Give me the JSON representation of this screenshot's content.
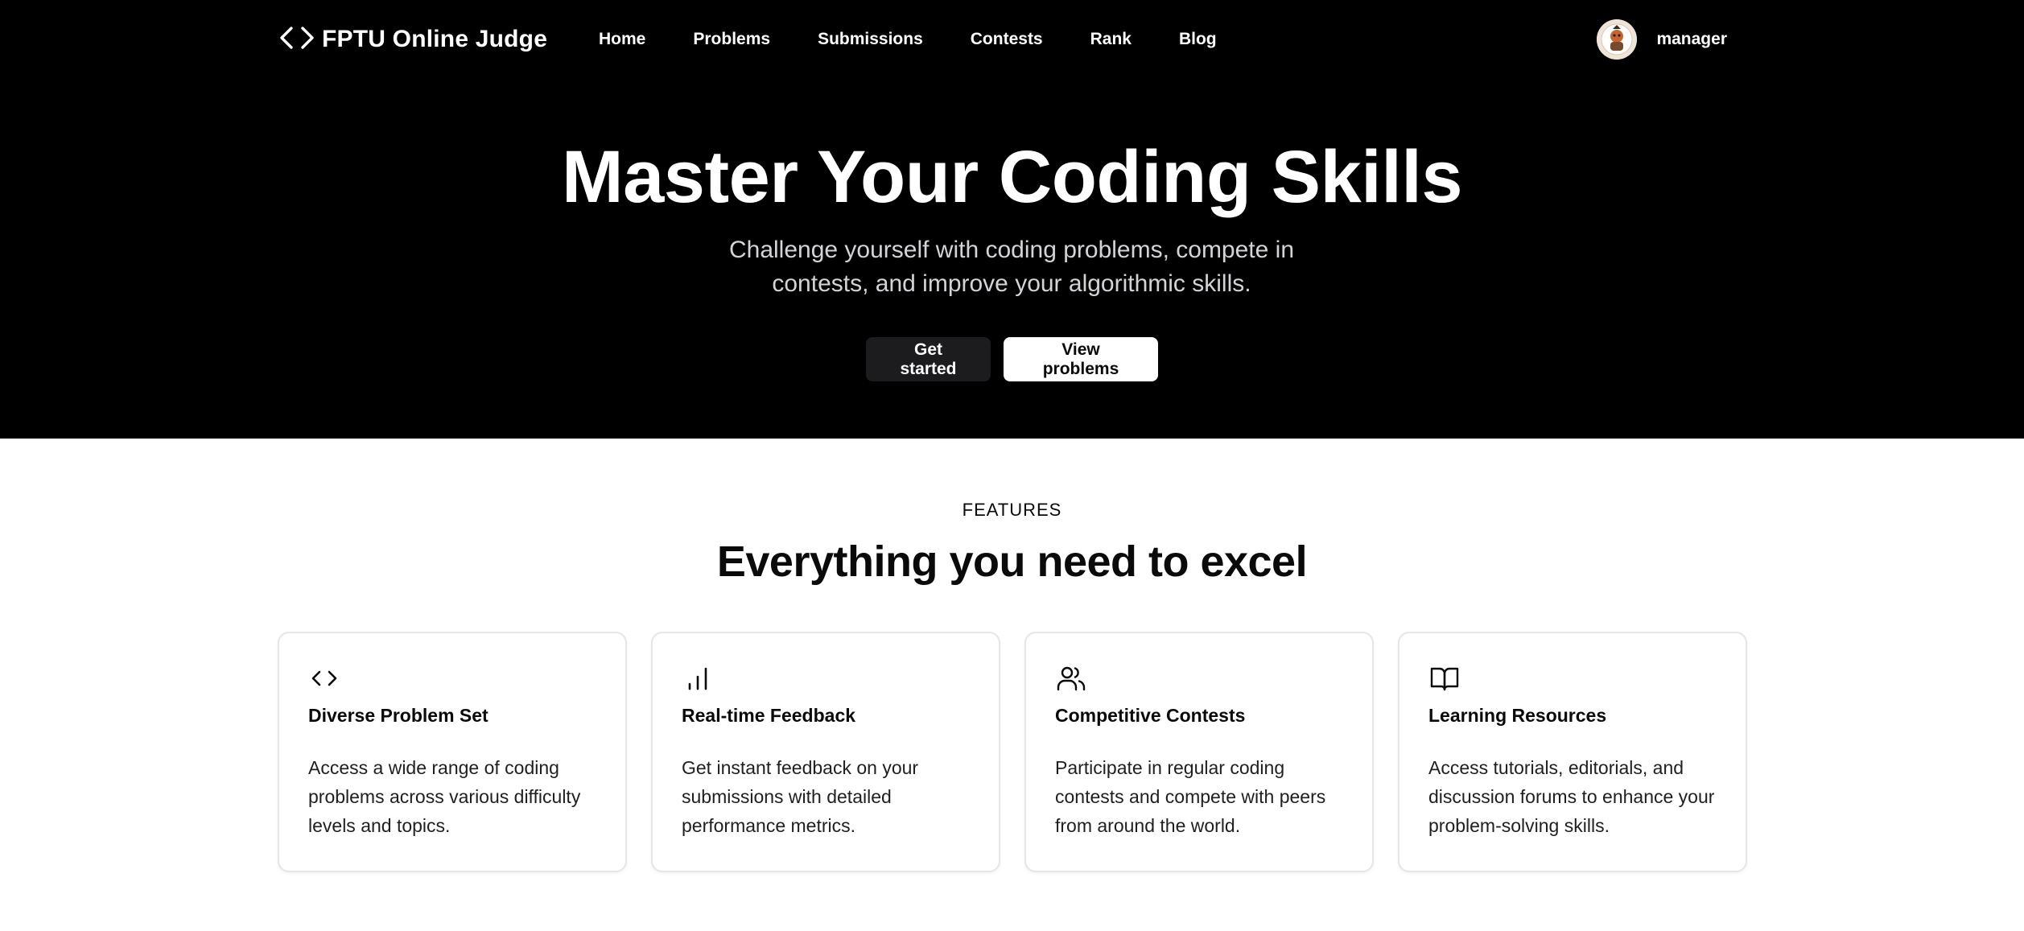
{
  "brand": {
    "name": "FPTU Online Judge",
    "icon": "code-brackets-icon"
  },
  "nav": {
    "items": [
      {
        "label": "Home"
      },
      {
        "label": "Problems"
      },
      {
        "label": "Submissions"
      },
      {
        "label": "Contests"
      },
      {
        "label": "Rank"
      },
      {
        "label": "Blog"
      }
    ]
  },
  "user": {
    "name": "manager",
    "avatar_icon": "user-avatar"
  },
  "hero": {
    "title": "Master Your Coding Skills",
    "subtitle": "Challenge yourself with coding problems, compete in contests, and improve your algorithmic skills.",
    "primary_button": "Get started",
    "secondary_button": "View problems"
  },
  "features": {
    "eyebrow": "FEATURES",
    "heading": "Everything you need to excel",
    "cards": [
      {
        "icon": "code-icon",
        "title": "Diverse Problem Set",
        "description": "Access a wide range of coding problems across various difficulty levels and topics."
      },
      {
        "icon": "bar-chart-icon",
        "title": "Real-time Feedback",
        "description": "Get instant feedback on your submissions with detailed performance metrics."
      },
      {
        "icon": "users-icon",
        "title": "Competitive Contests",
        "description": "Participate in regular coding contests and compete with peers from around the world."
      },
      {
        "icon": "book-open-icon",
        "title": "Learning Resources",
        "description": "Access tutorials, editorials, and discussion forums to enhance your problem-solving skills."
      }
    ]
  },
  "colors": {
    "hero_background": "#000000",
    "page_background": "#ffffff",
    "primary_button_bg": "#1c1c1e",
    "card_border": "#e6e6e8"
  }
}
